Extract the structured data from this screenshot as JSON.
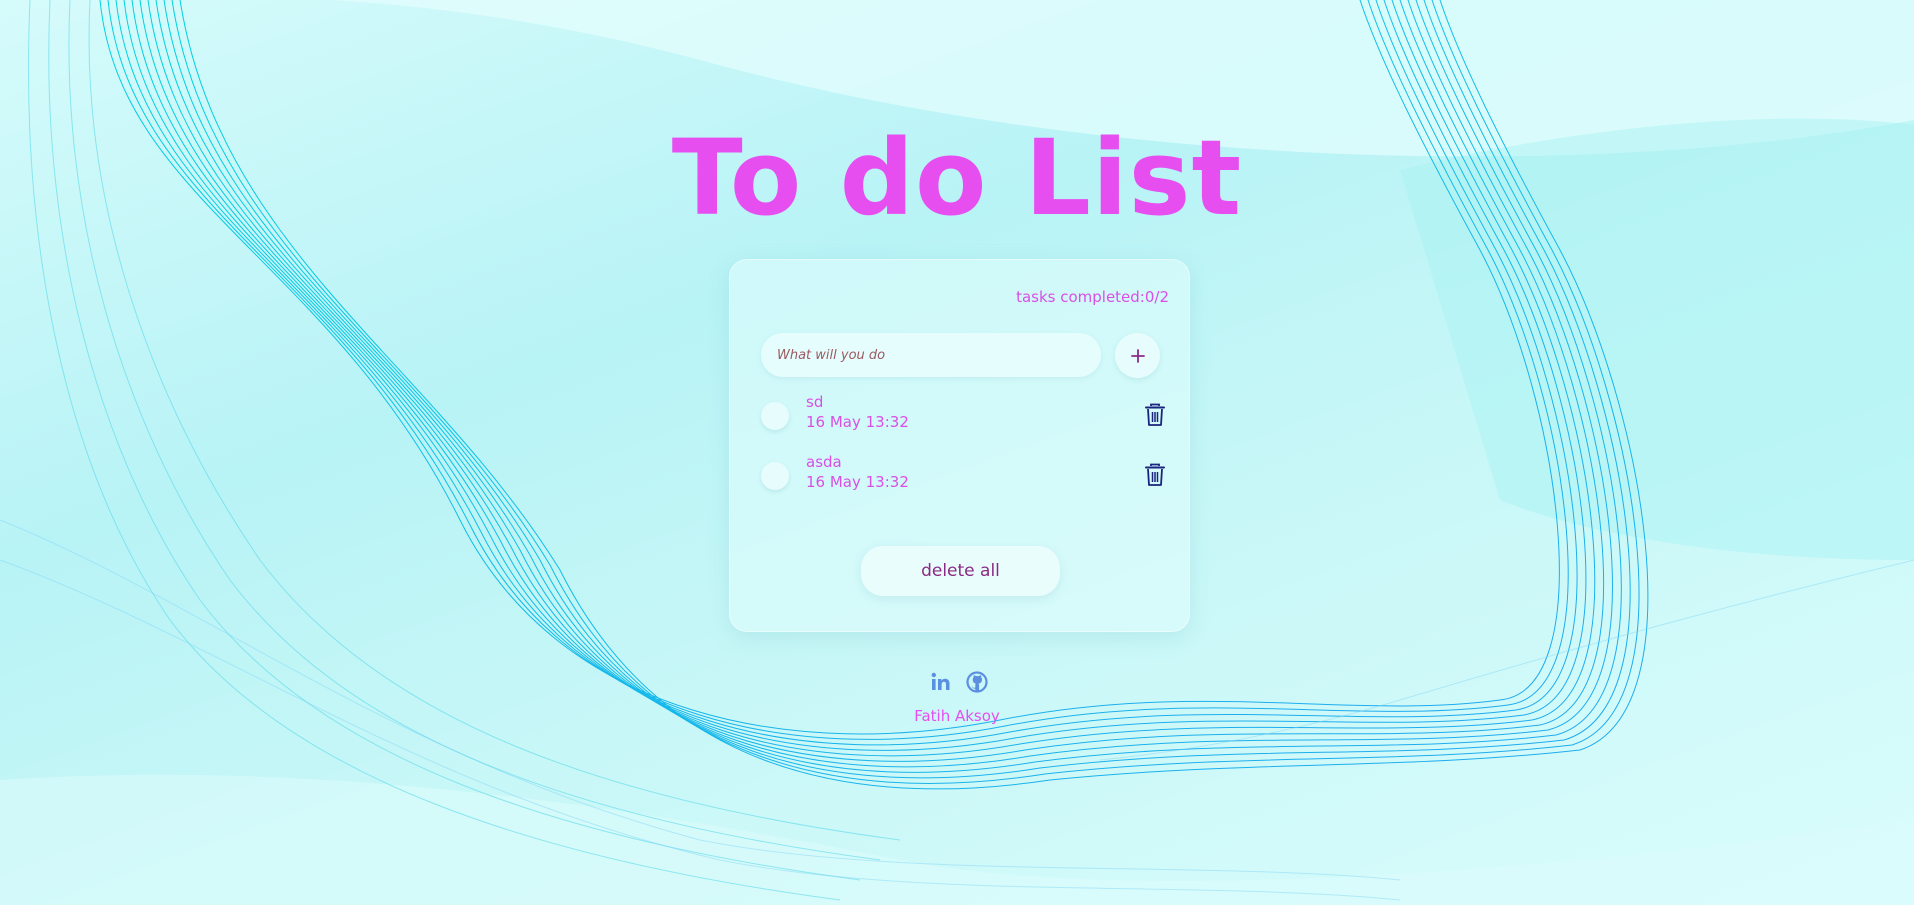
{
  "app": {
    "title": "To do List"
  },
  "card": {
    "counter_text": "tasks completed:0/2",
    "input": {
      "placeholder": "What will you do",
      "value": ""
    },
    "add_button_icon": "plus-icon",
    "tasks": [
      {
        "name": "sd",
        "date": "16 May 13:32",
        "completed": false,
        "delete_icon": "trash-icon"
      },
      {
        "name": "asda",
        "date": "16 May 13:32",
        "completed": false,
        "delete_icon": "trash-icon"
      }
    ],
    "delete_all_label": "delete all"
  },
  "footer": {
    "social_icons": [
      "linkedin-icon",
      "github-icon"
    ],
    "author": "Fatih Aksoy"
  },
  "colors": {
    "title": "#e74ef0",
    "accent_text": "#d94fe6",
    "icon_dark": "#1a237e",
    "social_blue": "#5b8fe0",
    "background": "#c8f7f7"
  }
}
